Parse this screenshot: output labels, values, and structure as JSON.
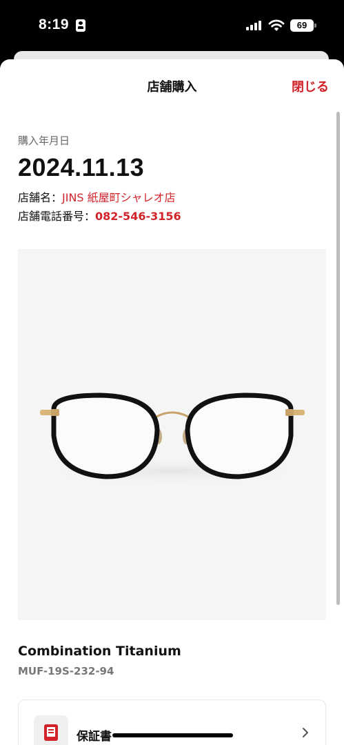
{
  "status_bar": {
    "time": "8:19",
    "battery_level": "69",
    "icons": [
      "person-badge-icon",
      "cellular-signal-icon",
      "wifi-icon",
      "battery-icon"
    ]
  },
  "header": {
    "title": "店舗購入",
    "close_label": "閉じる"
  },
  "purchase": {
    "date_label": "購入年月日",
    "date_value": "2024.11.13",
    "store_name_label": "店舗名：",
    "store_name_value": "JINS 紙屋町シャレオ店",
    "store_phone_label": "店舗電話番号：",
    "store_phone_value": "082-546-3156"
  },
  "product": {
    "name": "Combination Titanium",
    "code": "MUF-19S-232-94"
  },
  "card": {
    "label": "保証書",
    "icon": "document-icon"
  },
  "colors": {
    "accent": "#d2232a",
    "text": "#111111",
    "muted": "#777777"
  }
}
